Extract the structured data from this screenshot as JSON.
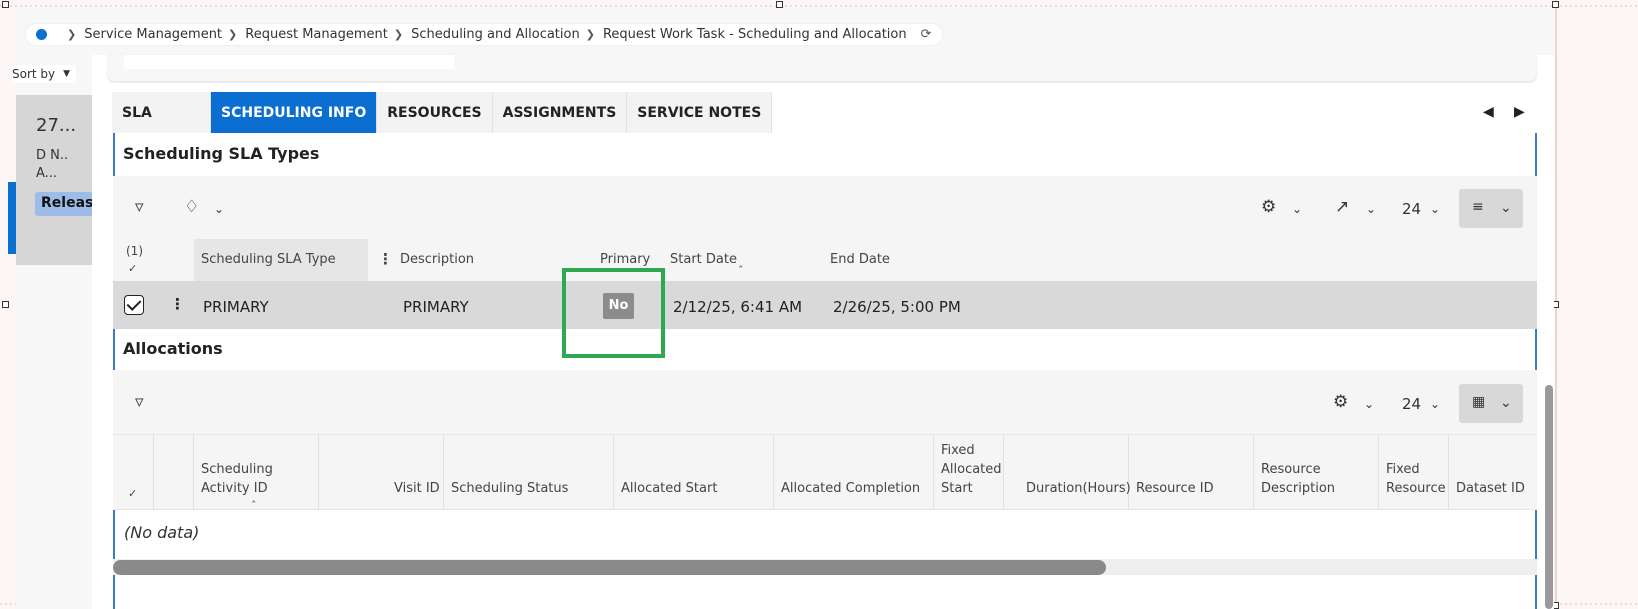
{
  "breadcrumb": {
    "items": [
      "Service Management",
      "Request Management",
      "Scheduling and Allocation",
      "Request Work Task - Scheduling and Allocation"
    ]
  },
  "sidebar": {
    "sort_label": "Sort by",
    "card": {
      "number": "27...",
      "line1": "D  N..",
      "line2": "A...",
      "status": "Released"
    }
  },
  "tabs": [
    {
      "label": "SLA",
      "active": false
    },
    {
      "label": "SCHEDULING INFO",
      "active": true
    },
    {
      "label": "RESOURCES",
      "active": false
    },
    {
      "label": "ASSIGNMENTS",
      "active": false
    },
    {
      "label": "SERVICE NOTES",
      "active": false
    }
  ],
  "sla_section": {
    "title": "Scheduling SLA Types",
    "page_size": "24",
    "selected_count": "(1)",
    "columns": [
      "Scheduling SLA Type",
      "Description",
      "Primary",
      "Start Date",
      "End Date"
    ],
    "rows": [
      {
        "type": "PRIMARY",
        "description": "PRIMARY",
        "primary": "No",
        "start_date": "2/12/25, 6:41 AM",
        "end_date": "2/26/25, 5:00 PM"
      }
    ]
  },
  "allocations_section": {
    "title": "Allocations",
    "page_size": "24",
    "columns": [
      {
        "label": "Scheduling Activity ID"
      },
      {
        "label": "Visit ID"
      },
      {
        "label": "Scheduling Status"
      },
      {
        "label": "Allocated Start"
      },
      {
        "label": "Allocated Completion"
      },
      {
        "label": "Fixed Allocated Start"
      },
      {
        "label": "Duration(Hours)"
      },
      {
        "label": "Resource ID"
      },
      {
        "label": "Resource Description"
      },
      {
        "label": "Fixed Resource"
      },
      {
        "label": "Dataset ID"
      }
    ],
    "empty_text": "(No data)"
  },
  "colors": {
    "accent": "#0b6fd1",
    "highlight": "#2fa84f",
    "badge_bg": "#8c8c8c",
    "status_badge": "#9dbde8"
  }
}
